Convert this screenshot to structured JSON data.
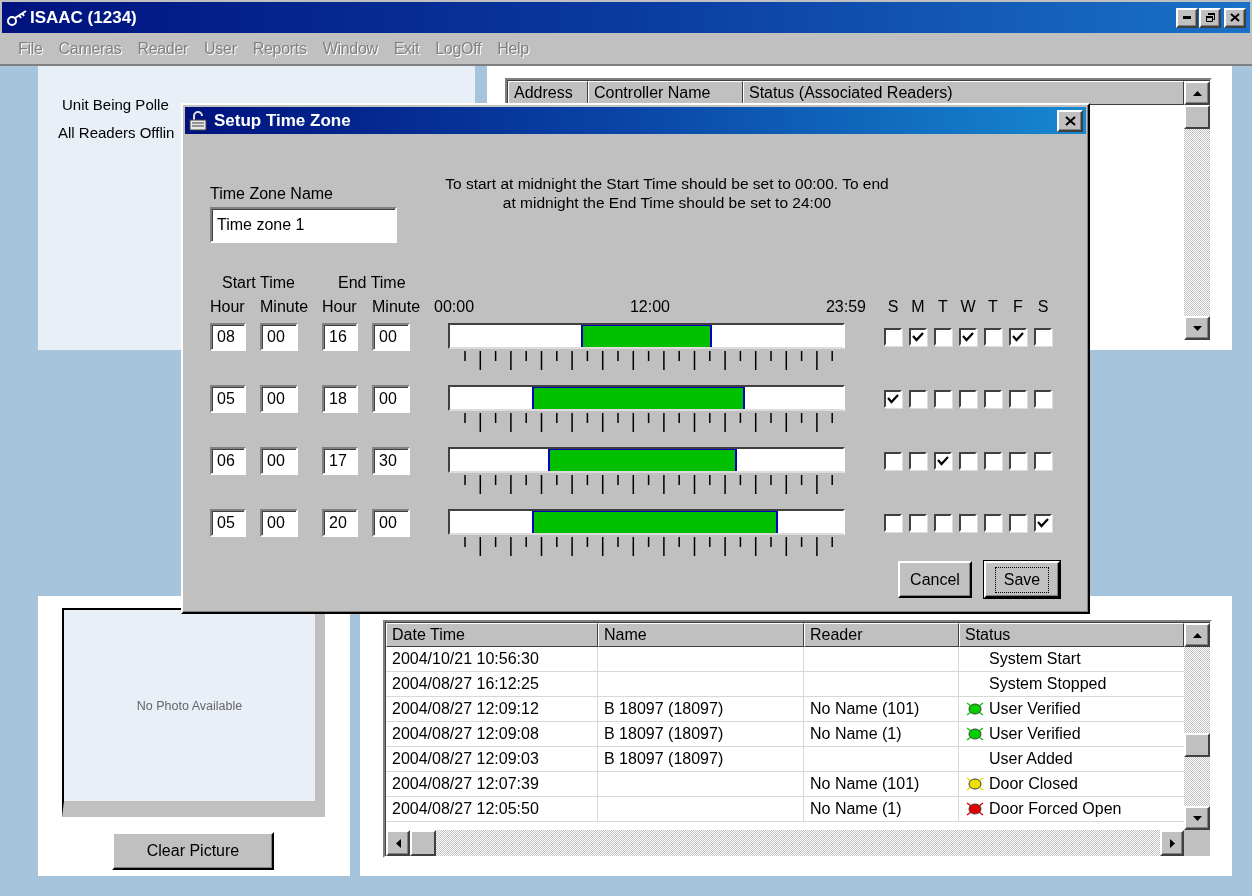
{
  "window": {
    "title": "ISAAC (1234)"
  },
  "menu": [
    {
      "label": "File",
      "disabled": true
    },
    {
      "label": "Cameras",
      "disabled": true
    },
    {
      "label": "Reader",
      "disabled": true
    },
    {
      "label": "User",
      "disabled": true
    },
    {
      "label": "Reports",
      "disabled": true
    },
    {
      "label": "Window",
      "disabled": true
    },
    {
      "label": "Exit",
      "disabled": true
    },
    {
      "label": "LogOff",
      "disabled": true
    },
    {
      "label": "Help",
      "disabled": true
    }
  ],
  "status_panel": {
    "lines": [
      "Unit Being Polle",
      "All Readers Offlin"
    ]
  },
  "controllers_table": {
    "columns": [
      "Address",
      "Controller Name",
      "Status (Associated Readers)"
    ]
  },
  "photo": {
    "placeholder": "No Photo Available",
    "button": "Clear Picture"
  },
  "events_table": {
    "columns": [
      "Date Time",
      "Name",
      "Reader",
      "Status"
    ],
    "rows": [
      {
        "date_time": "2004/10/21 10:56:30",
        "status": "System Start"
      },
      {
        "date_time": "2004/08/27 16:12:25",
        "status": "System Stopped"
      },
      {
        "date_time": "2004/08/27 12:09:12",
        "name": "B 18097  (18097)",
        "reader": "No Name  (101)",
        "status": "User Verified",
        "color": "#00d000"
      },
      {
        "date_time": "2004/08/27 12:09:08",
        "name": "B 18097  (18097)",
        "reader": "No Name  (1)",
        "status": "User Verified",
        "color": "#00d000"
      },
      {
        "date_time": "2004/08/27 12:09:03",
        "name": "B 18097  (18097)",
        "status": "User Added"
      },
      {
        "date_time": "2004/08/27 12:07:39",
        "reader": "No Name  (101)",
        "status": "Door Closed",
        "color": "#f0e000"
      },
      {
        "date_time": "2004/08/27 12:05:50",
        "reader": "No Name  (1)",
        "status": "Door Forced Open",
        "color": "#e00000"
      }
    ]
  },
  "dialog": {
    "title": "Setup Time Zone",
    "name_label": "Time Zone Name",
    "name_value": "Time zone 1",
    "instructions": [
      "To start at midnight the Start Time  should be set to 00:00.  To end",
      "at midnight the End Time should be set to 24:00"
    ],
    "start_label": "Start Time",
    "end_label": "End Time",
    "sub_labels": [
      "Hour",
      "Minute",
      "Hour",
      "Minute"
    ],
    "scale_labels": [
      "00:00",
      "12:00",
      "23:59"
    ],
    "day_labels": [
      "S",
      "M",
      "T",
      "W",
      "T",
      "F",
      "S"
    ],
    "zones": [
      {
        "start_hour": "08",
        "start_minute": "00",
        "end_hour": "16",
        "end_minute": "00",
        "days": [
          {
            "checked": false
          },
          {
            "checked": true
          },
          {
            "checked": false
          },
          {
            "checked": true
          },
          {
            "checked": false
          },
          {
            "checked": true
          },
          {
            "checked": false
          }
        ]
      },
      {
        "start_hour": "05",
        "start_minute": "00",
        "end_hour": "18",
        "end_minute": "00",
        "days": [
          {
            "checked": true
          },
          {
            "checked": false
          },
          {
            "checked": false
          },
          {
            "checked": false
          },
          {
            "checked": false
          },
          {
            "checked": false
          },
          {
            "checked": false
          }
        ]
      },
      {
        "start_hour": "06",
        "start_minute": "00",
        "end_hour": "17",
        "end_minute": "30",
        "days": [
          {
            "checked": false
          },
          {
            "checked": false
          },
          {
            "checked": true
          },
          {
            "checked": false
          },
          {
            "checked": false
          },
          {
            "checked": false
          },
          {
            "checked": false
          }
        ]
      },
      {
        "start_hour": "05",
        "start_minute": "00",
        "end_hour": "20",
        "end_minute": "00",
        "days": [
          {
            "checked": false
          },
          {
            "checked": false
          },
          {
            "checked": false
          },
          {
            "checked": false
          },
          {
            "checked": false
          },
          {
            "checked": false
          },
          {
            "checked": true
          }
        ]
      }
    ],
    "buttons": [
      {
        "label": "Cancel",
        "default": false
      },
      {
        "label": "Save",
        "default": true
      }
    ]
  }
}
